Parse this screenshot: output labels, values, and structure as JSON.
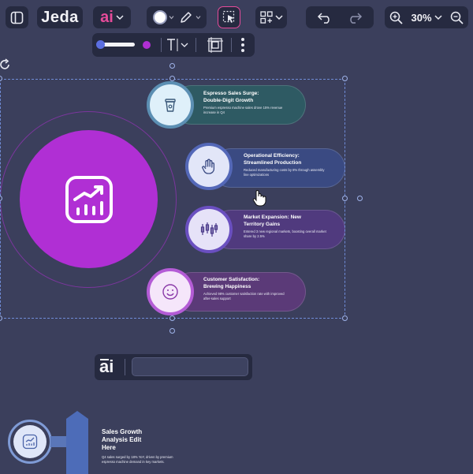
{
  "toolbar": {
    "logo": "Jeda",
    "ai_label": "ai",
    "zoom_label": "30%"
  },
  "colors": {
    "background": "#3b3f5c",
    "toolbar_bg": "#262a40",
    "accent_pink": "#e64b9a",
    "hub_purple": "#b02fd4",
    "selection_blue": "#6f8bd6"
  },
  "infographic": {
    "hub_icon": "chart-growth-icon",
    "items": [
      {
        "icon": "coffee-cup-icon",
        "title": "Espresso Sales Surge:\nDouble-Digit Growth",
        "description": "Premium espresso machine sales drove 15% revenue increase in Q4"
      },
      {
        "icon": "hand-pointer-icon",
        "title": "Operational Efficiency:\nStreamlined Production",
        "description": "Reduced manufacturing costs by 8% through assembly line optimizations"
      },
      {
        "icon": "candlestick-icon",
        "title": "Market Expansion: New\nTerritory Gains",
        "description": "Entered 3 new regional markets, boosting overall market share by 2.5%"
      },
      {
        "icon": "smiley-icon",
        "title": "Customer Satisfaction:\nBrewing Happiness",
        "description": "Achieved 98% customer satisfaction rate with improved after-sales support"
      }
    ]
  },
  "ai_bar": {
    "label": "ai",
    "placeholder": ""
  },
  "thumbnail": {
    "title": "Sales Growth\nAnalysis Edit\nHere",
    "description": "Q4 sales surged by 18% YoY, driven by premium espresso machine demand in key markets."
  }
}
